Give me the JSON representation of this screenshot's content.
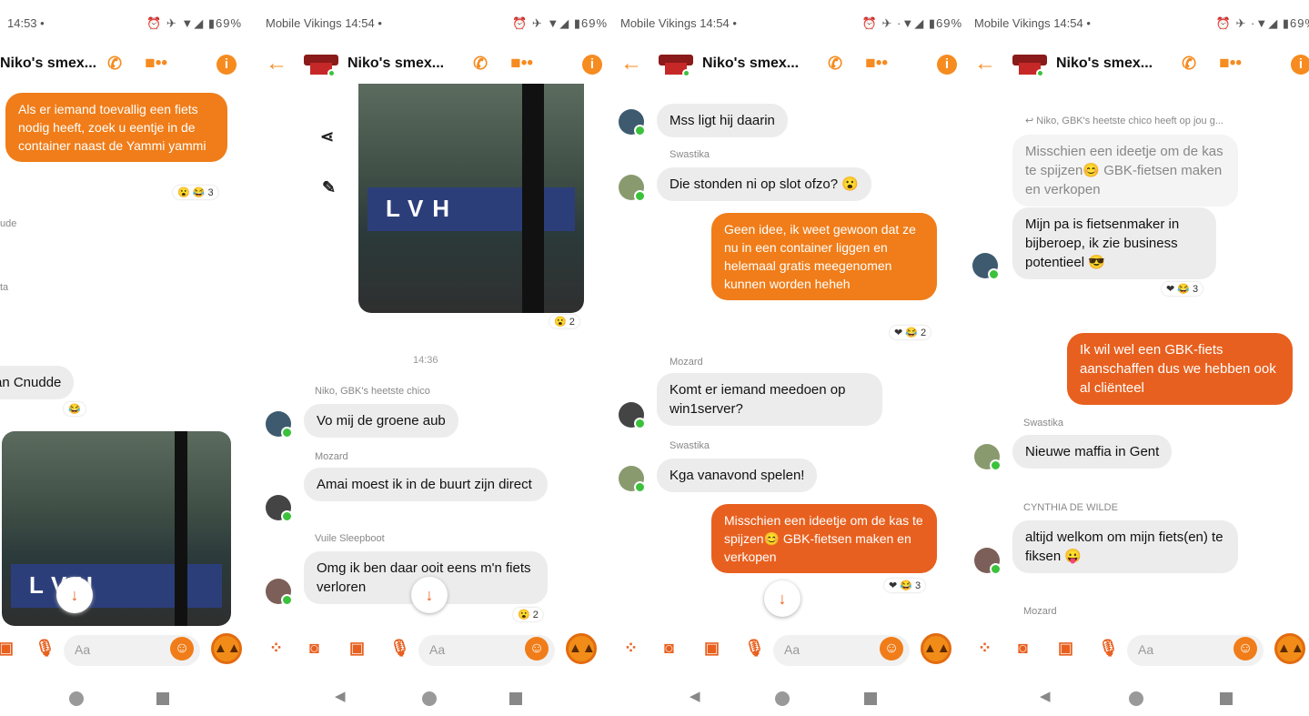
{
  "panels": [
    {
      "status_left": "14:53 •",
      "status_right": "⏰ ✈ ▼◢ ▮69%",
      "header": {
        "title": "Niko's smex..."
      },
      "messages": {
        "out1": "Als er iemand toevallig een fiets nodig heeft, zoek u eentje in de container naast de Yammi yammi",
        "react1": "😮 😂 3",
        "sender1": "ude",
        "sender2": "ta",
        "in1": "an Cnudde",
        "react2": "😂",
        "photo_sign": "LVH"
      },
      "composer": {
        "placeholder": "Aa"
      }
    },
    {
      "status_left": "Mobile Vikings 14:54 •",
      "status_right": "⏰ ✈ ▼◢ ▮69%",
      "header": {
        "title": "Niko's smex..."
      },
      "messages": {
        "photo_sign": "LVH",
        "react1": "😮 2",
        "time": "14:36",
        "sender1": "Niko, GBK's heetste chico",
        "in1": "Vo mij de groene aub",
        "sender2": "Mozard",
        "in2": "Amai moest ik in de buurt zijn direct",
        "sender3": "Vuile Sleepboot",
        "in3": "Omg ik ben daar ooit eens m'n fiets verloren",
        "react2": "😮 2"
      },
      "composer": {
        "placeholder": "Aa"
      }
    },
    {
      "status_left": "Mobile Vikings 14:54 •",
      "status_right": "⏰ ✈ ·▼◢ ▮69%",
      "header": {
        "title": "Niko's smex..."
      },
      "messages": {
        "in1": "Mss ligt hij daarin",
        "sender1": "Swastika",
        "in2": "Die stonden ni op slot ofzo? 😮",
        "out1": "Geen idee, ik weet gewoon dat ze nu in een container liggen en helemaal gratis meegenomen kunnen worden heheh",
        "react1": "❤ 😂 2",
        "sender2": "Mozard",
        "in3": "Komt er iemand meedoen op win1server?",
        "sender3": "Swastika",
        "in4": "Kga vanavond spelen!",
        "out2": "Misschien een ideetje om de kas te spijzen😊 GBK-fietsen maken en verkopen",
        "react2": "❤ 😂 3"
      },
      "composer": {
        "placeholder": "Aa"
      }
    },
    {
      "status_left": "Mobile Vikings 14:54 •",
      "status_right": "⏰ ✈ ·▼◢ ▮69%",
      "header": {
        "title": "Niko's smex..."
      },
      "messages": {
        "reply_note": "↩ Niko, GBK's heetste chico heeft op jou g...",
        "quoted": "Misschien een ideetje om de kas te spijzen😊 GBK-fietsen maken en verkopen",
        "in1": "Mijn pa is fietsenmaker in bijberoep, ik zie business potentieel 😎",
        "react1": "❤ 😂 3",
        "out1": "Ik wil wel een GBK-fiets aanschaffen dus we hebben ook al cliënteel",
        "sender1": "Swastika",
        "in2": "Nieuwe maffia in Gent",
        "sender2": "CYNTHIA DE WILDE",
        "in3": "altijd welkom om mijn fiets(en) te fiksen 😛",
        "sender3": "Mozard"
      },
      "composer": {
        "placeholder": "Aa"
      }
    }
  ],
  "colors": {
    "accent": "#f68b1f",
    "outgoing": "#f07d19",
    "outgoing_dark": "#e8601f",
    "incoming": "#ececec"
  }
}
